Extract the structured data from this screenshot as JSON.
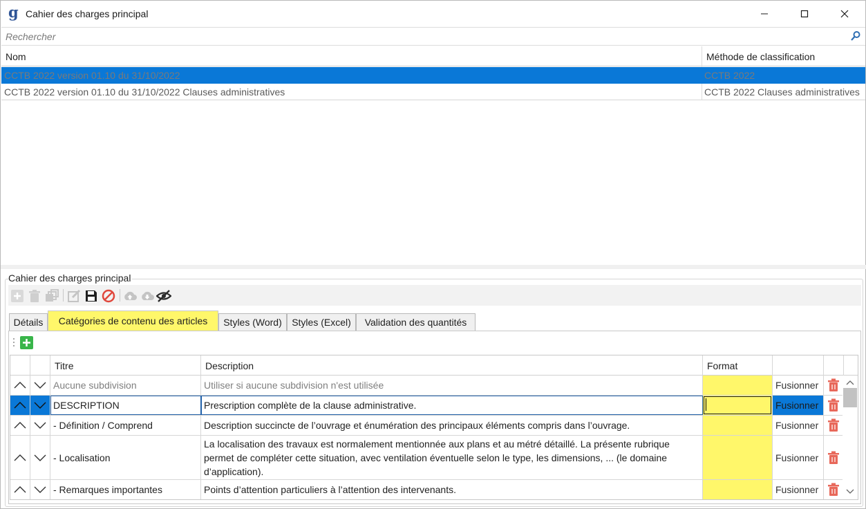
{
  "window": {
    "title": "Cahier des charges principal",
    "app_icon": "g"
  },
  "search": {
    "placeholder": "Rechercher"
  },
  "top_grid": {
    "columns": [
      "Nom",
      "Méthode de classification"
    ],
    "rows": [
      {
        "nom": "CCTB 2022 version 01.10 du 31/10/2022",
        "methode": "CCTB 2022",
        "selected": true
      },
      {
        "nom": "CCTB 2022 version 01.10 du 31/10/2022 Clauses administratives",
        "methode": "CCTB 2022 Clauses administratives",
        "selected": false
      }
    ]
  },
  "group": {
    "title": "Cahier des charges principal"
  },
  "toolbar": {
    "icons": [
      "add-icon",
      "delete-icon",
      "duplicate-icon",
      "edit-icon",
      "save-icon",
      "cancel-icon",
      "upload-icon",
      "download-icon",
      "hide-icon"
    ]
  },
  "tabs": [
    {
      "label": "Détails",
      "active": false
    },
    {
      "label": "Catégories de contenu des articles",
      "active": true
    },
    {
      "label": "Styles (Word)",
      "active": false
    },
    {
      "label": "Styles (Excel)",
      "active": false
    },
    {
      "label": "Validation des quantités",
      "active": false
    }
  ],
  "grid": {
    "columns": [
      "Titre",
      "Description",
      "Format"
    ],
    "rows": [
      {
        "titre": "Aucune subdivision",
        "description": "Utiliser si aucune subdivision n'est utilisée",
        "format": "",
        "merge": "Fusionner",
        "style": "grey"
      },
      {
        "titre": "DESCRIPTION",
        "description": "Prescription complète de la clause administrative.",
        "format": "",
        "merge": "Fusionner",
        "style": "selected"
      },
      {
        "titre": "- Définition / Comprend",
        "description": "Description succincte de l’ouvrage et énumération des principaux éléments compris dans l’ouvrage.",
        "format": "",
        "merge": "Fusionner",
        "style": "normal"
      },
      {
        "titre": "- Localisation",
        "description": "La localisation des travaux est normalement mentionnée aux plans et au métré détaillé.  La présente rubrique permet de compléter cette situation, avec ventilation éventuelle selon le type, les dimensions, ... (le domaine d’application).",
        "format": "",
        "merge": "Fusionner",
        "style": "normal"
      },
      {
        "titre": "- Remarques importantes",
        "description": "Points d’attention particuliers à l’attention des intervenants.",
        "format": "",
        "merge": "Fusionner",
        "style": "normal"
      }
    ]
  },
  "colors": {
    "selection": "#0a78d7",
    "highlight_yellow": "#fff76a",
    "trash_red": "#e8685a",
    "add_green": "#39b54a"
  }
}
